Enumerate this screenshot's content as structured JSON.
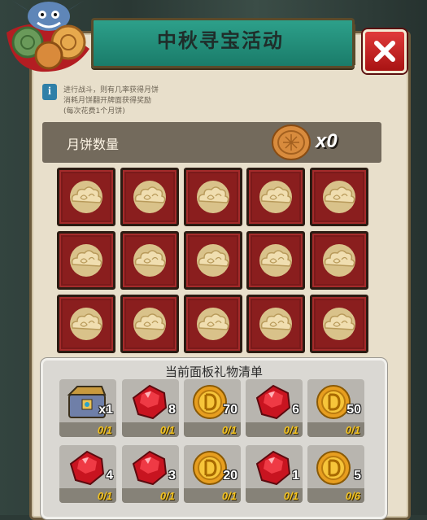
{
  "window": {
    "title": "中秋寻宝活动",
    "close_icon": "close-icon"
  },
  "info": {
    "icon": "info-icon",
    "lines": [
      "进行战斗，则有几率获得月饼",
      "消耗月饼翻开牌面获得奖励",
      "(每次花费1个月饼)"
    ]
  },
  "counter": {
    "label": "月饼数量",
    "icon": "mooncake-icon",
    "value": "x0"
  },
  "grid": {
    "rows": 3,
    "cols": 5,
    "card_icon": "cloud-pattern-icon",
    "card_color": "#7a1a1a"
  },
  "rewards": {
    "title": "当前面板礼物清单",
    "items": [
      {
        "icon": "treasure-chest-icon",
        "count": "x1",
        "progress": "0/1"
      },
      {
        "icon": "red-gem-icon",
        "count": "8",
        "progress": "0/1"
      },
      {
        "icon": "gold-coin-icon",
        "count": "70",
        "progress": "0/1"
      },
      {
        "icon": "red-gem-icon",
        "count": "6",
        "progress": "0/1"
      },
      {
        "icon": "gold-coin-icon",
        "count": "50",
        "progress": "0/1"
      },
      {
        "icon": "red-gem-icon",
        "count": "4",
        "progress": "0/1"
      },
      {
        "icon": "red-gem-icon",
        "count": "3",
        "progress": "0/1"
      },
      {
        "icon": "gold-coin-icon",
        "count": "20",
        "progress": "0/1"
      },
      {
        "icon": "red-gem-icon",
        "count": "1",
        "progress": "0/1"
      },
      {
        "icon": "gold-coin-icon",
        "count": "5",
        "progress": "0/6"
      }
    ]
  },
  "colors": {
    "banner": "#1a7c6a",
    "close_button": "#c62222",
    "progress_text": "#f3c320"
  }
}
